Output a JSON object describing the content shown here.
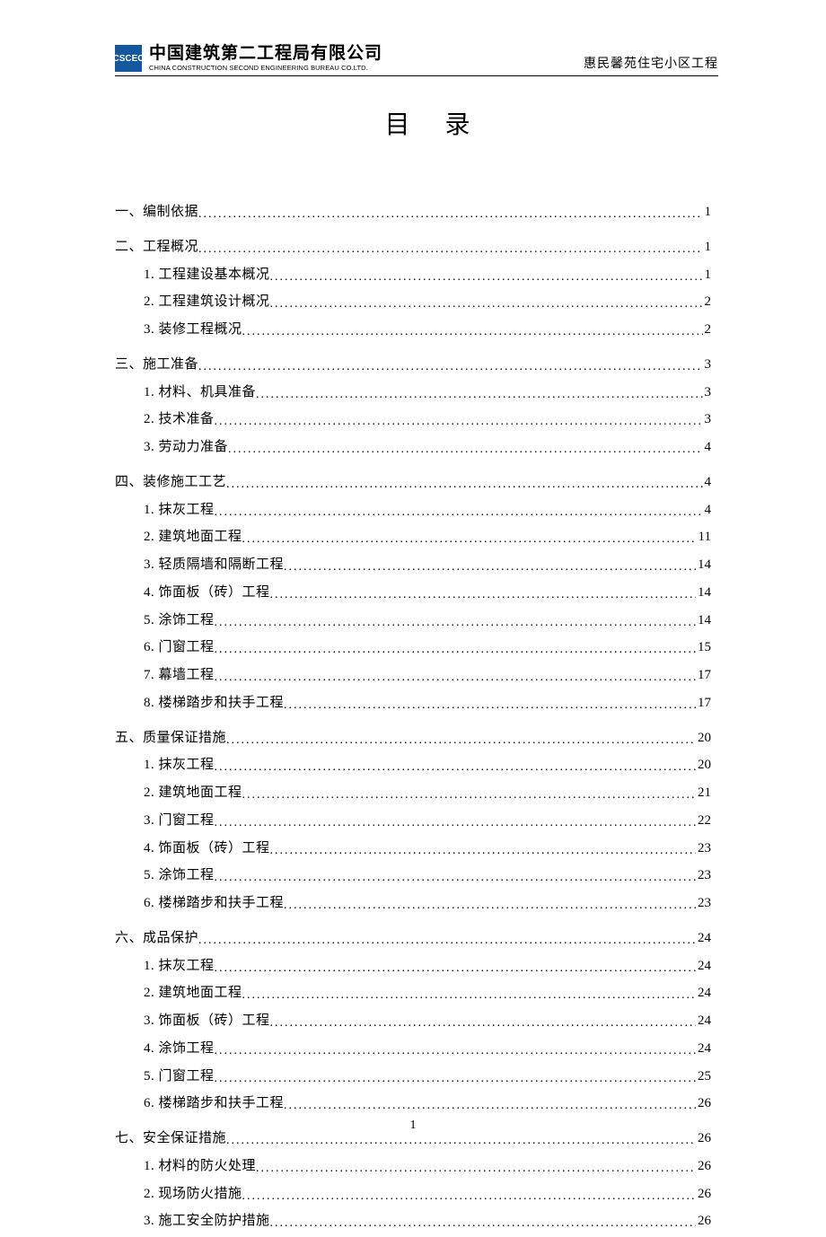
{
  "header": {
    "logo_text": "CSCEC",
    "company_cn": "中国建筑第二工程局有限公司",
    "company_en": "CHINA CONSTRUCTION SECOND ENGINEERING BUREAU CO.LTD.",
    "project_name": "惠民馨苑住宅小区工程"
  },
  "title": "目   录",
  "toc": [
    {
      "level": 1,
      "label": "一、编制依据",
      "page": "1"
    },
    {
      "level": 1,
      "label": "二、工程概况",
      "page": "1"
    },
    {
      "level": 2,
      "label": "1. 工程建设基本概况",
      "page": "1"
    },
    {
      "level": 2,
      "label": "2. 工程建筑设计概况",
      "page": "2"
    },
    {
      "level": 2,
      "label": "3. 装修工程概况",
      "page": "2"
    },
    {
      "level": 1,
      "label": "三、施工准备",
      "page": "3"
    },
    {
      "level": 2,
      "label": "1. 材料、机具准备",
      "page": "3"
    },
    {
      "level": 2,
      "label": "2. 技术准备",
      "page": "3"
    },
    {
      "level": 2,
      "label": "3. 劳动力准备",
      "page": "4"
    },
    {
      "level": 1,
      "label": "四、装修施工工艺",
      "page": "4"
    },
    {
      "level": 2,
      "label": "1. 抹灰工程",
      "page": "4"
    },
    {
      "level": 2,
      "label": "2. 建筑地面工程",
      "page": "11"
    },
    {
      "level": 2,
      "label": "3. 轻质隔墙和隔断工程",
      "page": "14"
    },
    {
      "level": 2,
      "label": "4. 饰面板（砖）工程",
      "page": "14"
    },
    {
      "level": 2,
      "label": "5. 涂饰工程",
      "page": "14"
    },
    {
      "level": 2,
      "label": "6. 门窗工程",
      "page": "15"
    },
    {
      "level": 2,
      "label": "7. 幕墙工程",
      "page": "17"
    },
    {
      "level": 2,
      "label": "8. 楼梯踏步和扶手工程",
      "page": "17"
    },
    {
      "level": 1,
      "label": "五、质量保证措施",
      "page": "20"
    },
    {
      "level": 2,
      "label": "1. 抹灰工程",
      "page": "20"
    },
    {
      "level": 2,
      "label": "2. 建筑地面工程",
      "page": "21"
    },
    {
      "level": 2,
      "label": "3. 门窗工程",
      "page": "22"
    },
    {
      "level": 2,
      "label": "4. 饰面板（砖）工程",
      "page": "23"
    },
    {
      "level": 2,
      "label": "5. 涂饰工程",
      "page": "23"
    },
    {
      "level": 2,
      "label": "6. 楼梯踏步和扶手工程",
      "page": "23"
    },
    {
      "level": 1,
      "label": "六、成品保护",
      "page": "24"
    },
    {
      "level": 2,
      "label": "1. 抹灰工程",
      "page": "24"
    },
    {
      "level": 2,
      "label": "2. 建筑地面工程",
      "page": "24"
    },
    {
      "level": 2,
      "label": "3. 饰面板（砖）工程",
      "page": "24"
    },
    {
      "level": 2,
      "label": "4. 涂饰工程",
      "page": "24"
    },
    {
      "level": 2,
      "label": "5. 门窗工程",
      "page": "25"
    },
    {
      "level": 2,
      "label": "6. 楼梯踏步和扶手工程",
      "page": "26"
    },
    {
      "level": 1,
      "label": "七、安全保证措施",
      "page": "26"
    },
    {
      "level": 2,
      "label": "1. 材料的防火处理",
      "page": "26"
    },
    {
      "level": 2,
      "label": "2. 现场防火措施",
      "page": "26"
    },
    {
      "level": 2,
      "label": "3. 施工安全防护措施",
      "page": "26"
    }
  ],
  "page_number": "1"
}
